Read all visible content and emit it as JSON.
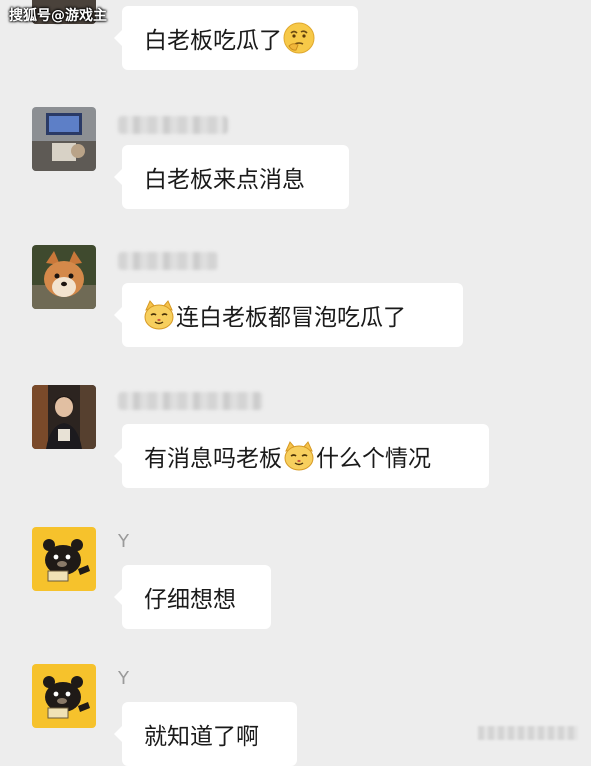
{
  "watermark": "搜狐号@游戏主",
  "messages": [
    {
      "sender": "",
      "sender_blurred": true,
      "parts": [
        "白老板吃瓜了",
        ""
      ],
      "emojis": [
        "thinking-face-icon"
      ]
    },
    {
      "sender": "",
      "sender_blurred": true,
      "parts": [
        "白老板来点消息"
      ],
      "emojis": []
    },
    {
      "sender": "",
      "sender_blurred": true,
      "parts": [
        "",
        "连白老板都冒泡吃瓜了"
      ],
      "emojis": [
        "cat-face-icon"
      ]
    },
    {
      "sender": "",
      "sender_blurred": true,
      "parts": [
        "有消息吗老板",
        "什么个情况"
      ],
      "emojis": [
        "cat-face-icon"
      ]
    },
    {
      "sender": "Y",
      "sender_blurred": false,
      "parts": [
        "仔细想想"
      ],
      "emojis": []
    },
    {
      "sender": "Y",
      "sender_blurred": false,
      "parts": [
        "就知道了啊"
      ],
      "emojis": []
    }
  ],
  "colors": {
    "background": "#ededed",
    "bubble": "#ffffff",
    "text": "#1a1a1a",
    "sender": "#9a9a9a"
  }
}
